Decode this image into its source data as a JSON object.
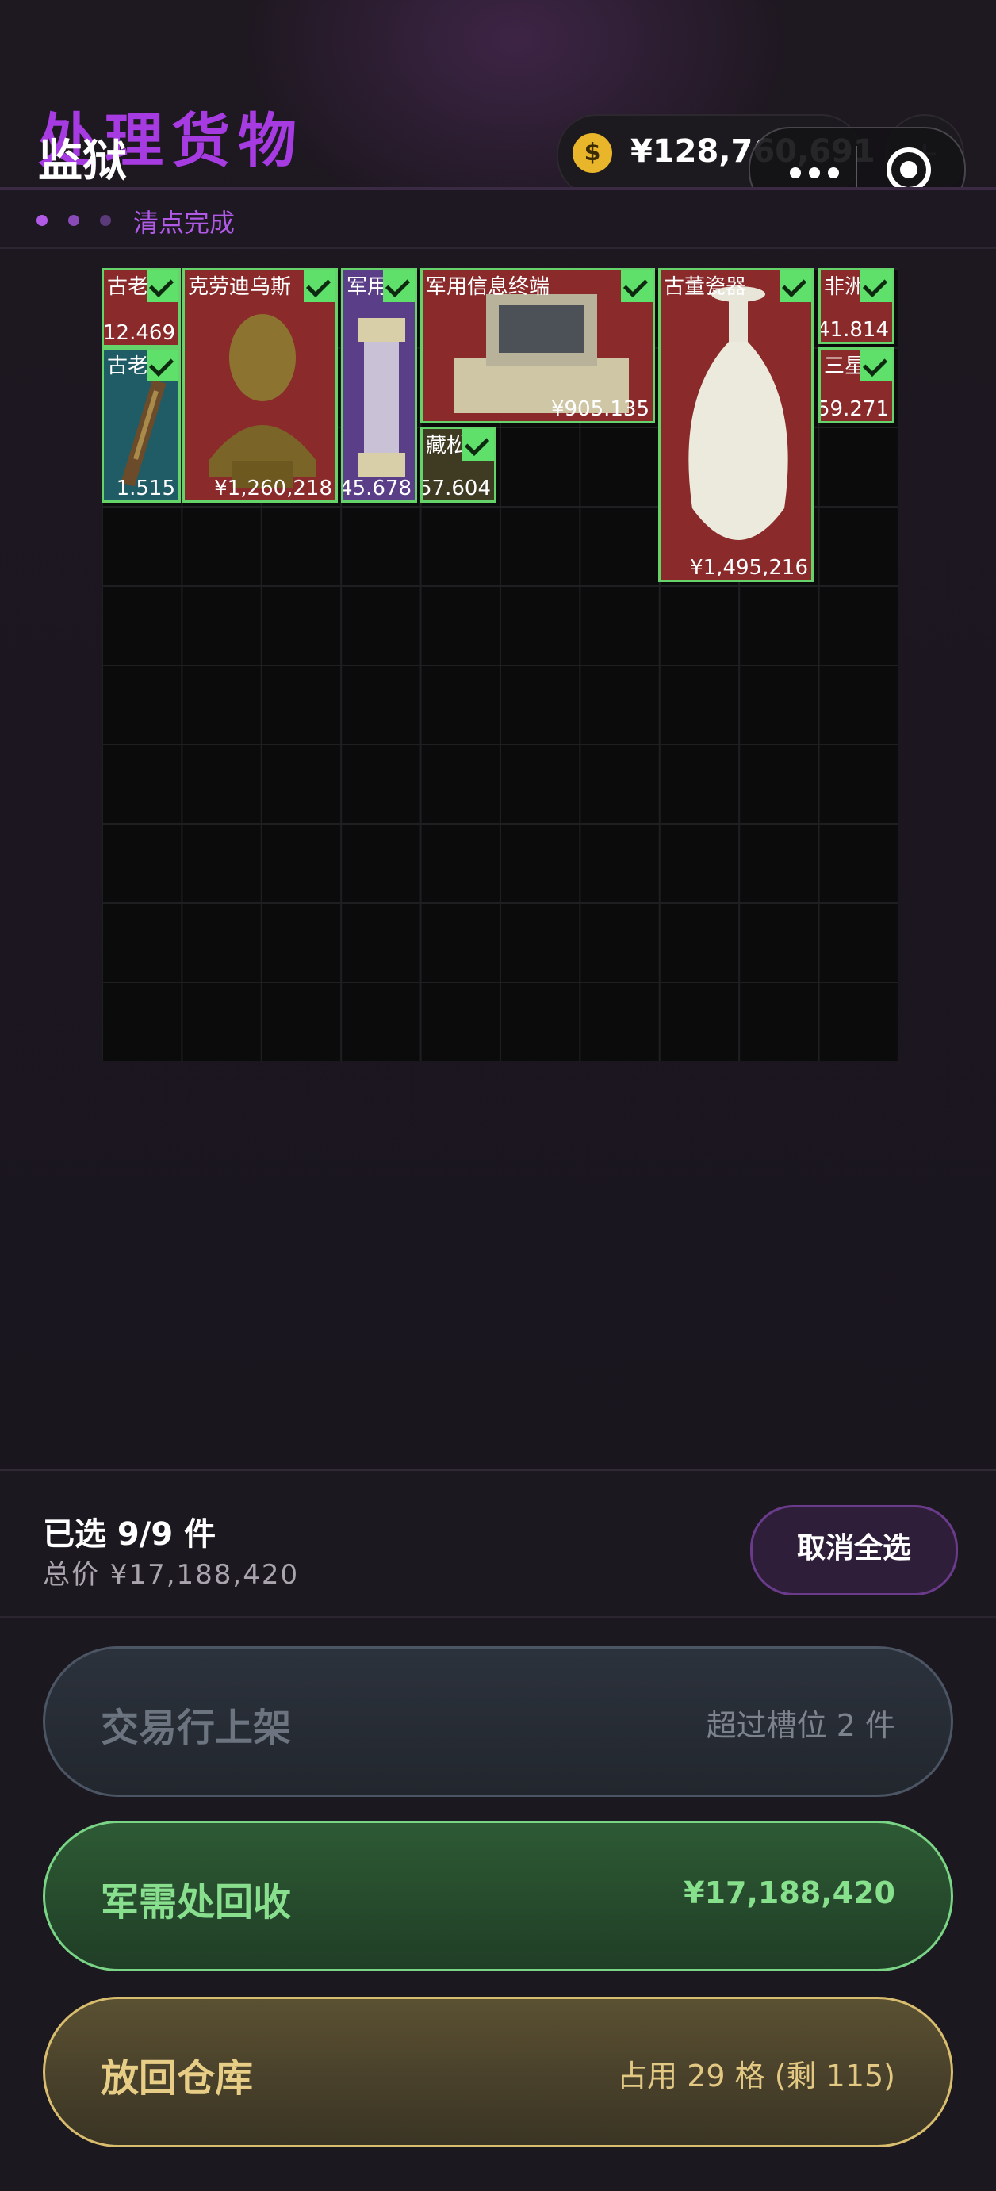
{
  "header": {
    "title_overlay": "处理货物",
    "title": "监狱",
    "currency_value": "¥128,760,691",
    "coin_symbol": "$",
    "plus_label": "+",
    "status": "清点完成"
  },
  "items": [
    {
      "name": "古老",
      "price": "12.469"
    },
    {
      "name": "克劳迪乌斯",
      "price": "¥1,260,218"
    },
    {
      "name": "军用",
      "price": "45.678"
    },
    {
      "name": "军用信息终端",
      "price": "¥905.135"
    },
    {
      "name": "古董瓷器",
      "price": "¥1,495,216"
    },
    {
      "name": "非洲",
      "price": "41.814"
    },
    {
      "name": "古老",
      "price": "1.515"
    },
    {
      "name": "藏松",
      "price": "57.604"
    },
    {
      "name": "三星",
      "price": "59.271"
    }
  ],
  "selection": {
    "count": "已选 9/9 件",
    "total": "总价 ¥17,188,420",
    "deselect_label": "取消全选"
  },
  "actions": {
    "market": {
      "label": "交易行上架",
      "info": "超过槽位 2 件"
    },
    "recycle": {
      "label": "军需处回收",
      "info": "¥17,188,420"
    },
    "return": {
      "label": "放回仓库",
      "info": "占用 29 格 (剩 115)"
    }
  },
  "colors": {
    "accent_purple": "#a53be0",
    "select_green": "#5fe06b",
    "rarity_red": "#8a2a2a",
    "rarity_teal": "#1f5c66",
    "rarity_purple": "#5a3f88"
  }
}
